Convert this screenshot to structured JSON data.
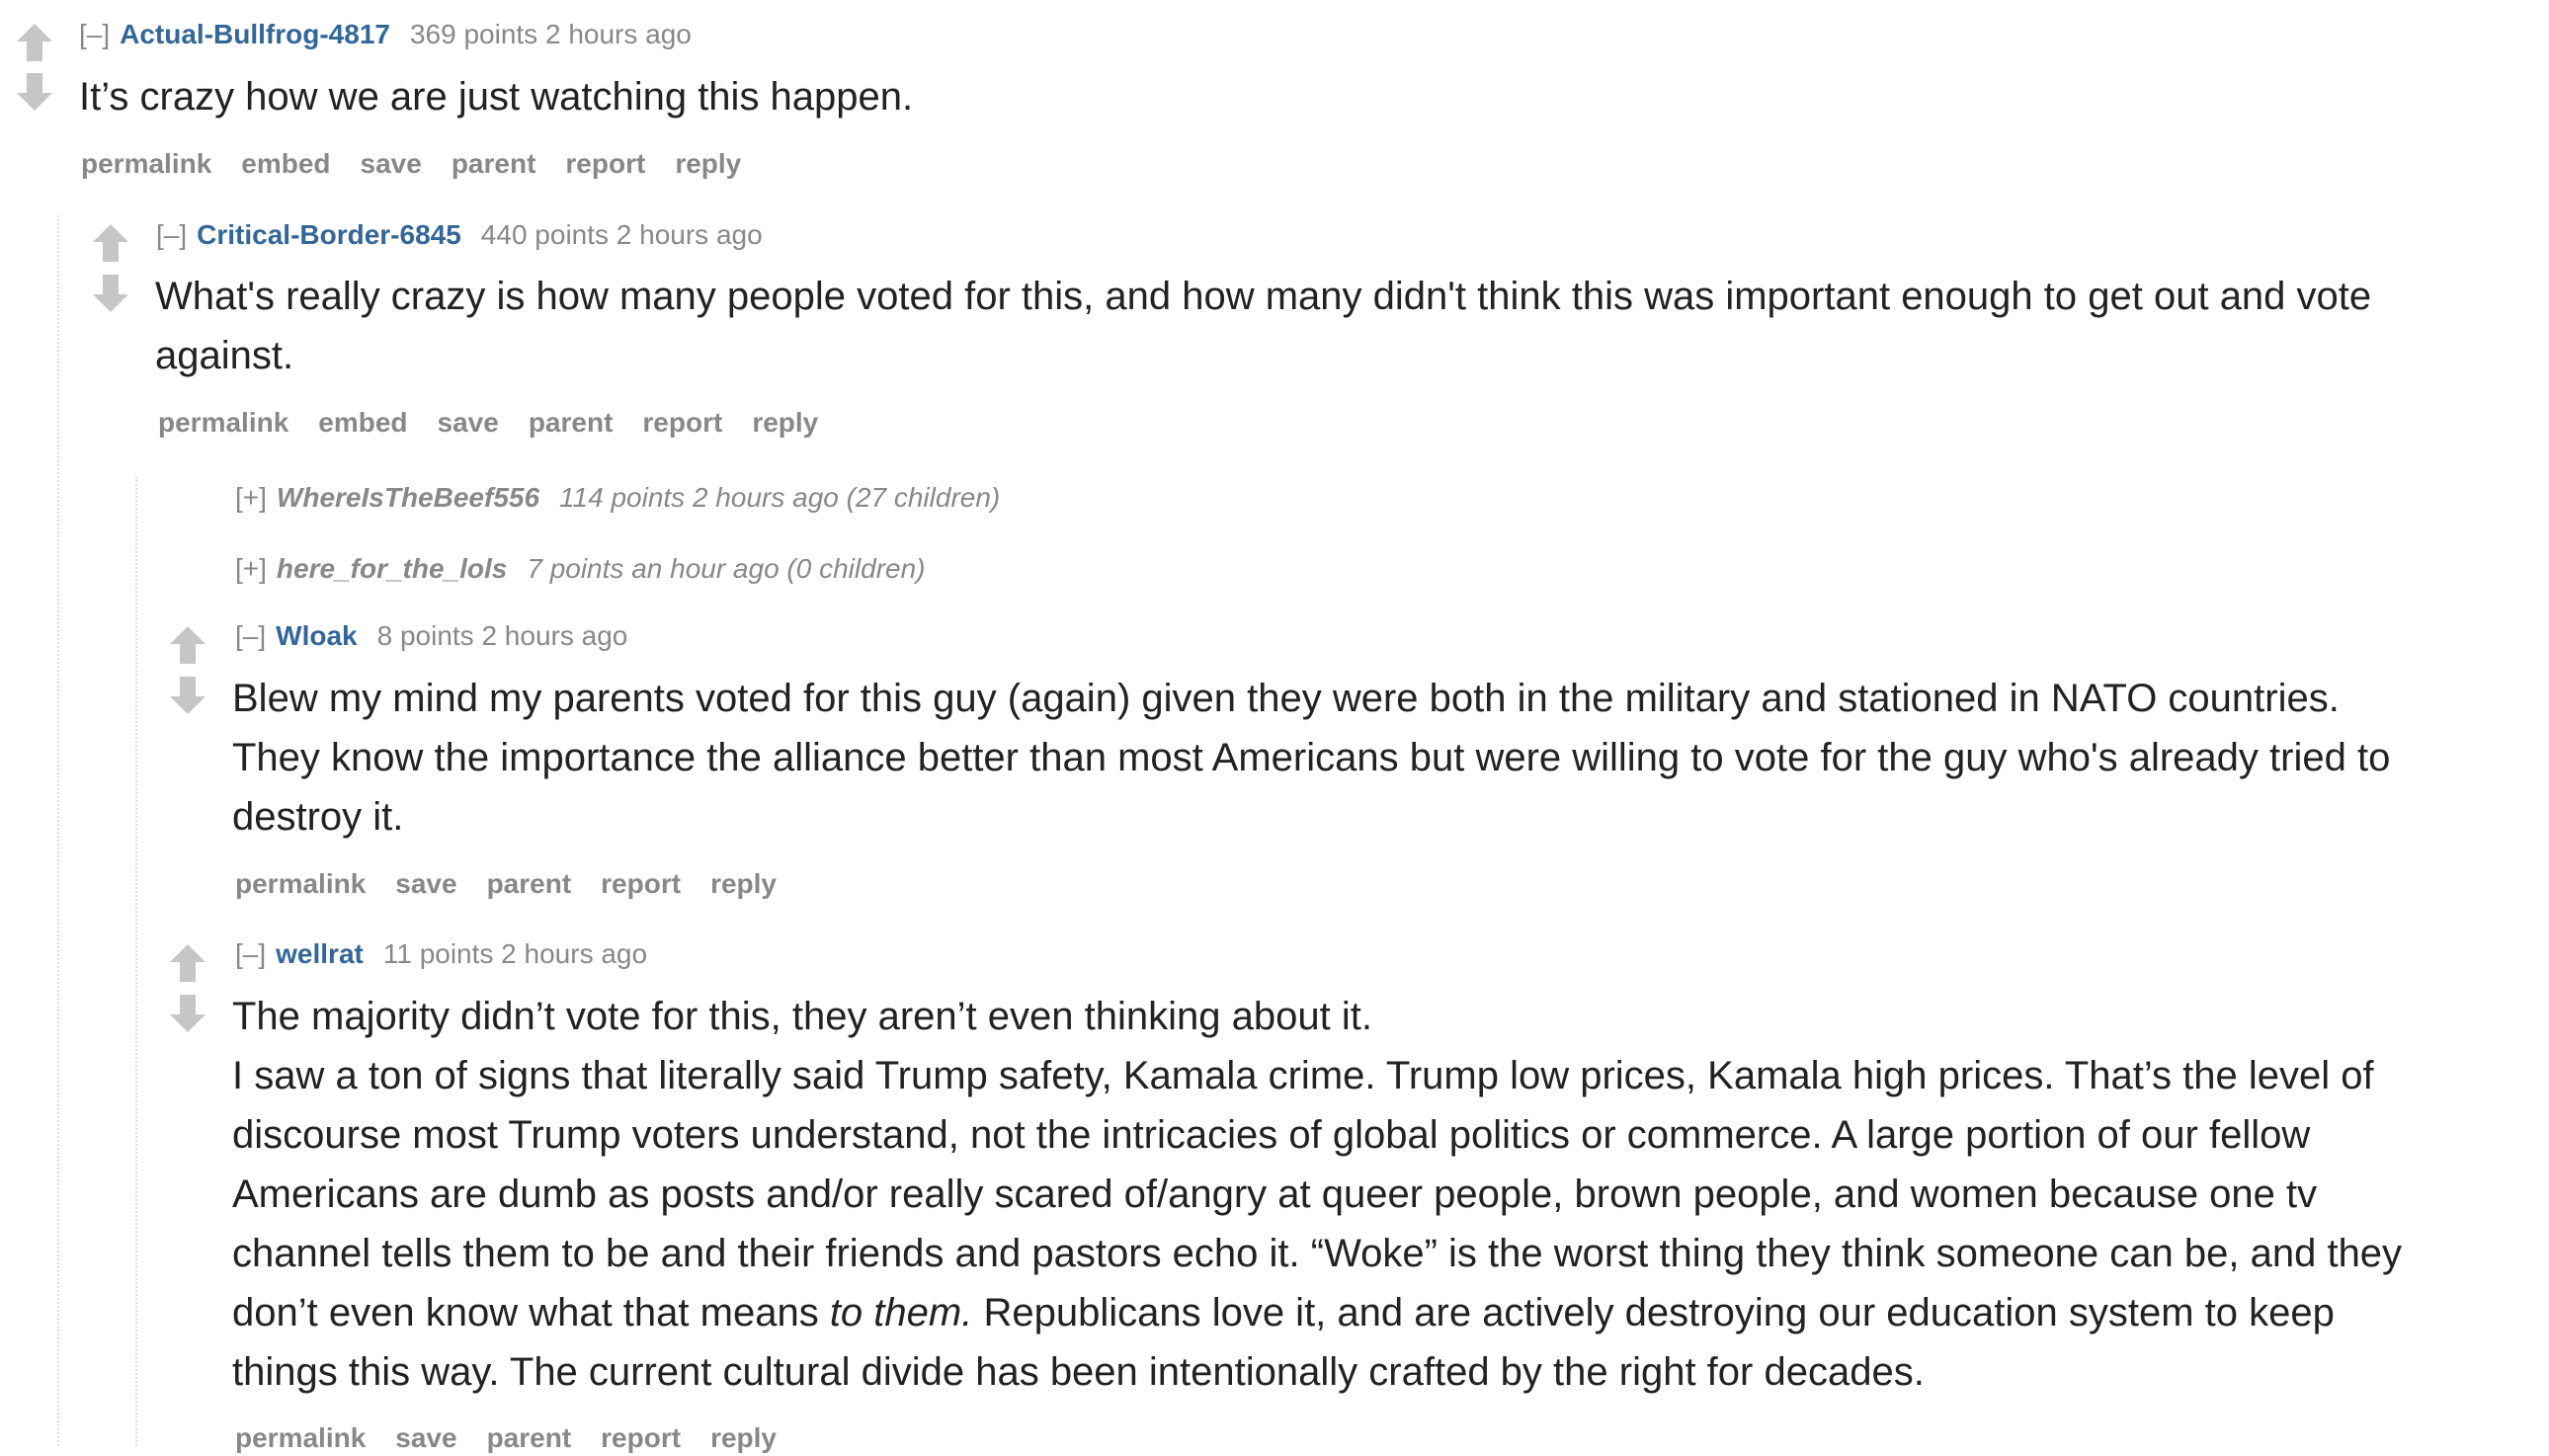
{
  "comments": {
    "c1": {
      "expand": "[–]",
      "author": "Actual-Bullfrog-4817",
      "meta": "369 points 2 hours ago",
      "body": "It’s crazy how we are just watching this happen.",
      "buttons": [
        "permalink",
        "embed",
        "save",
        "parent",
        "report",
        "reply"
      ]
    },
    "c2": {
      "expand": "[–]",
      "author": "Critical-Border-6845",
      "meta": "440 points 2 hours ago",
      "body_line1": "What's really crazy is how many people voted for this, and how many didn't think this was important enough to get out and vote",
      "body_line2": "against.",
      "buttons": [
        "permalink",
        "embed",
        "save",
        "parent",
        "report",
        "reply"
      ]
    },
    "c3": {
      "expand": "[+]",
      "author": "WhereIsTheBeef556",
      "meta": "114 points 2 hours ago (27 children)"
    },
    "c4": {
      "expand": "[+]",
      "author": "here_for_the_lols",
      "meta": "7 points an hour ago (0 children)"
    },
    "c5": {
      "expand": "[–]",
      "author": "Wloak",
      "meta": "8 points 2 hours ago",
      "body_line1": "Blew my mind my parents voted for this guy (again) given they were both in the military and stationed in NATO countries.",
      "body_line2": "They know the importance the alliance better than most Americans but were willing to vote for the guy who's already tried to",
      "body_line3": "destroy it.",
      "buttons": [
        "permalink",
        "save",
        "parent",
        "report",
        "reply"
      ]
    },
    "c6": {
      "expand": "[–]",
      "author": "wellrat",
      "meta": "11 points 2 hours ago",
      "p1": "The majority didn’t vote for this, they aren’t even thinking about it.",
      "p2_l1": "I saw a ton of signs that literally said Trump safety, Kamala crime. Trump low prices, Kamala high prices. That’s the level of",
      "p2_l2": "discourse most Trump voters understand, not the intricacies of global politics or commerce. A large portion of our fellow",
      "p2_l3": "Americans are dumb as posts and/or really scared of/angry at queer people, brown people, and women because one tv",
      "p2_l4": "channel tells them to be and their friends and pastors echo it. “Woke” is the worst thing they think someone can be, and they",
      "p2_l5a": "don’t even know what that means ",
      "p2_l5_em": "to them.",
      "p2_l5b": " Republicans love it, and are actively destroying our education system to keep",
      "p2_l6": "things this way. The current cultural divide has been intentionally crafted by the right for decades.",
      "buttons": [
        "permalink",
        "save",
        "parent",
        "report",
        "reply"
      ]
    }
  },
  "colors": {
    "author": "#336699",
    "muted": "#888888",
    "text": "#222222",
    "arrow": "#c6c6c6"
  },
  "icons": {
    "upvote": "upvote-arrow-icon",
    "downvote": "downvote-arrow-icon"
  }
}
